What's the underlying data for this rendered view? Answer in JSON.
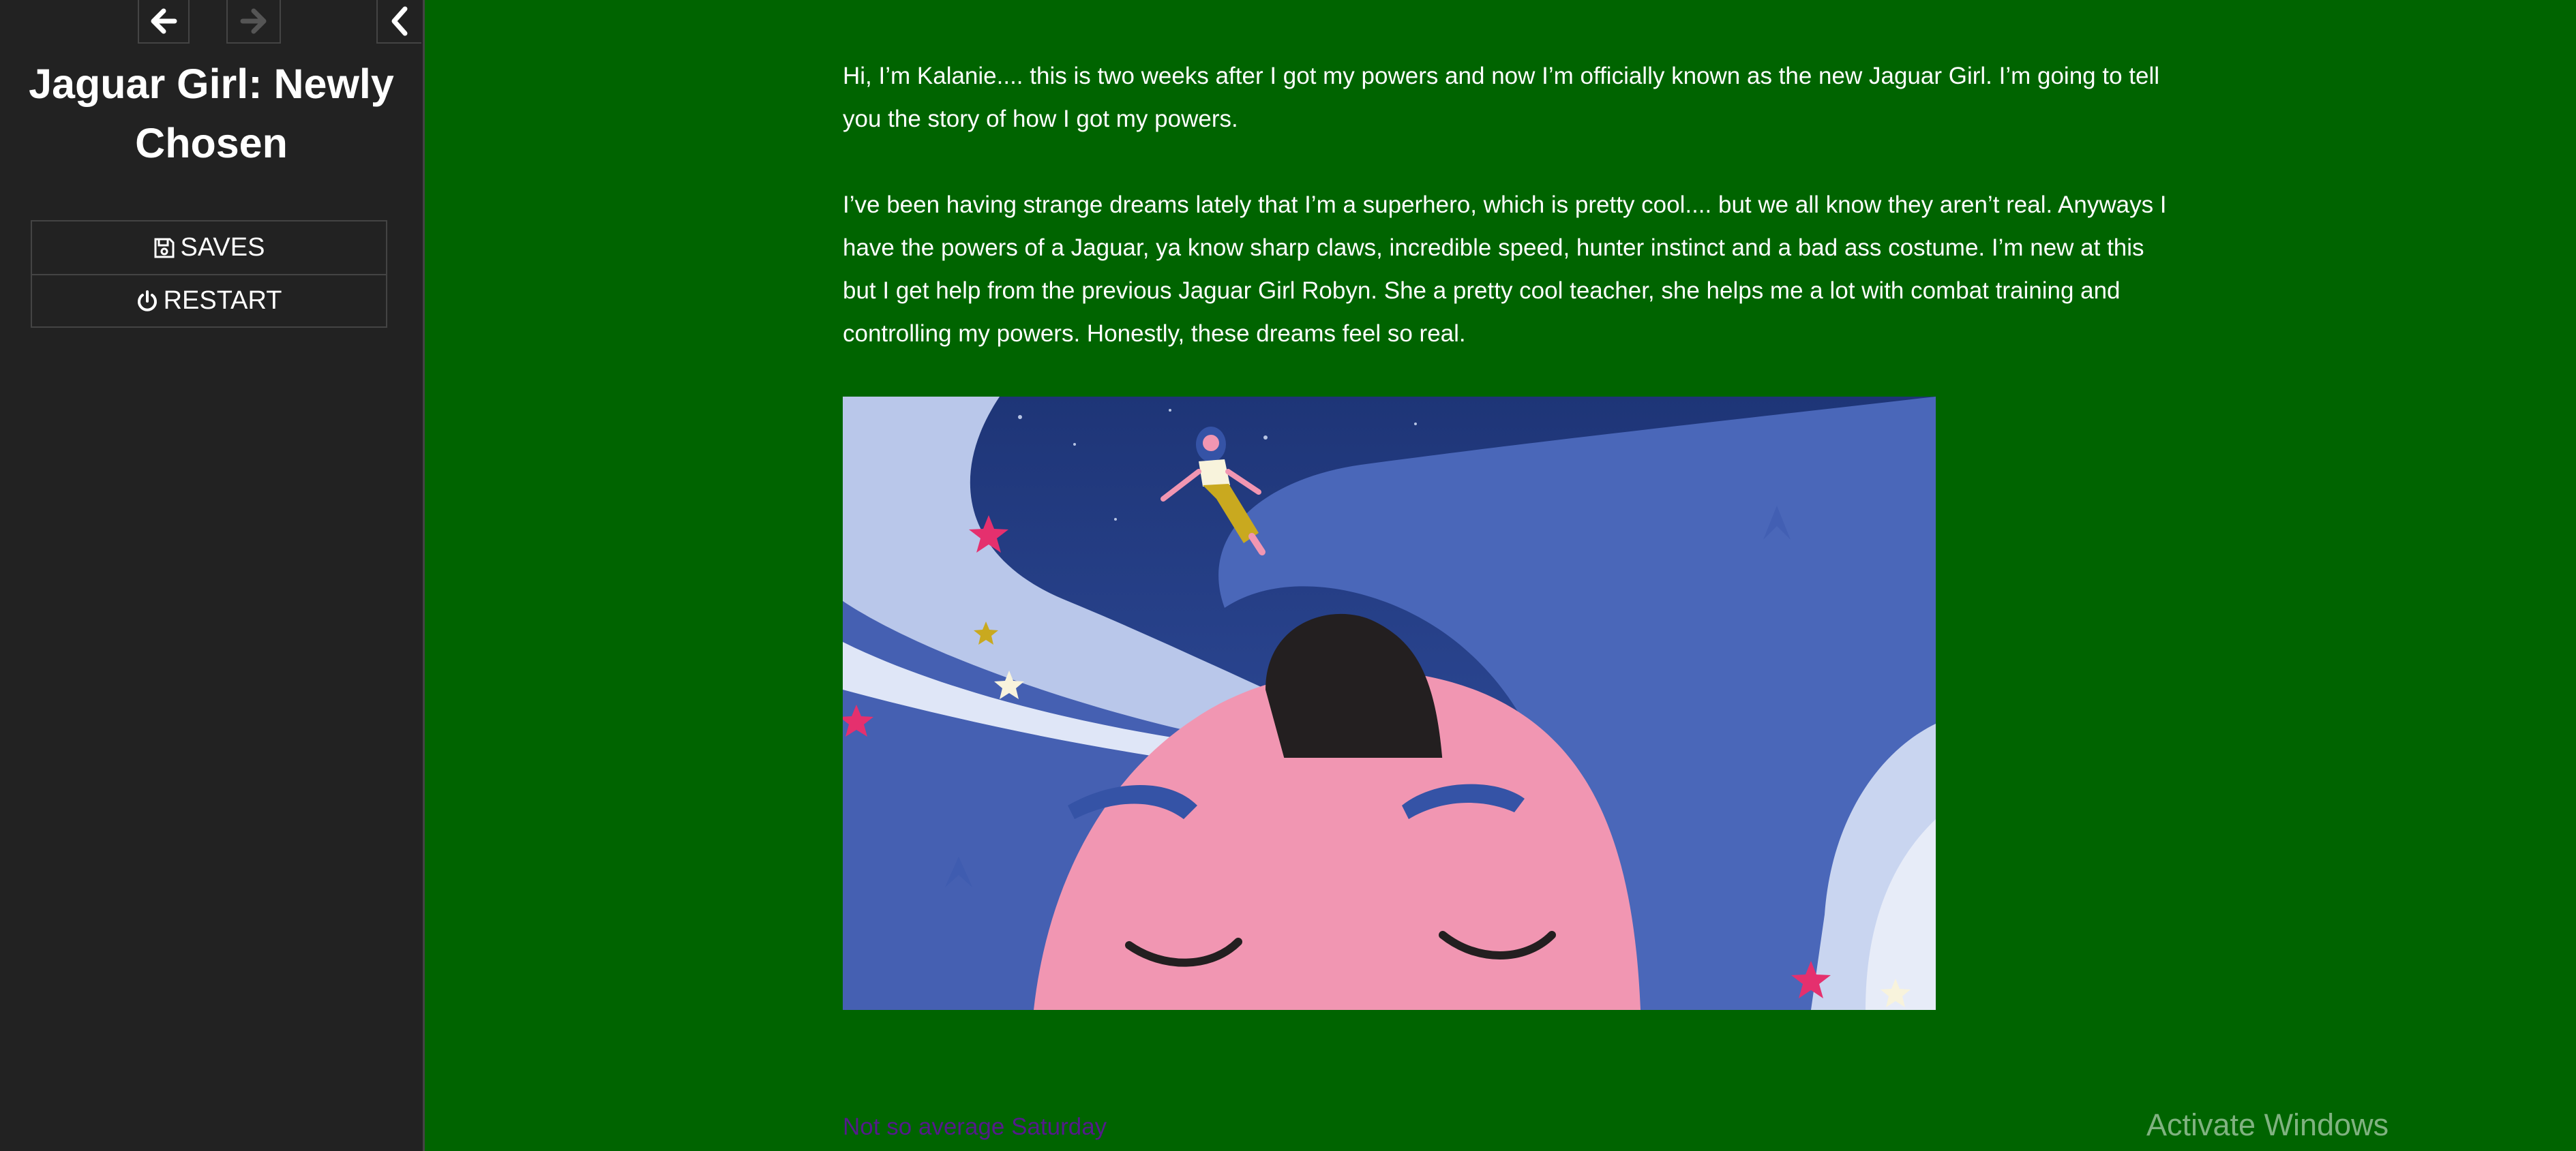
{
  "sidebar": {
    "back_icon": "arrow-left-icon",
    "forward_icon": "arrow-right-icon",
    "toggle_icon": "chevron-left-icon",
    "title": "Jaguar Girl: Newly Chosen",
    "menu": [
      {
        "label": "SAVES",
        "icon": "floppy-disk-icon"
      },
      {
        "label": "RESTART",
        "icon": "power-icon"
      }
    ]
  },
  "passage": {
    "paragraphs": [
      "Hi, I’m Kalanie.... this is two weeks after I got my powers and now I’m officially known as the new Jaguar Girl. I’m going to tell you the story of how I got my powers.",
      "I’ve been having strange dreams lately that I’m a superhero, which is pretty cool.... but we all know they aren’t real. Anyways I have the powers of a Jaguar, ya know sharp claws, incredible speed, hunter instinct and a bad ass costume. I’m new at this but I get help from the previous Jaguar Girl Robyn. She a pretty cool teacher, she helps me a lot with combat training and controlling my powers. Honestly, these dreams feel so real."
    ],
    "next_link": "Not so average Saturday"
  },
  "watermark": "Activate Windows",
  "colors": {
    "background": "#006400",
    "sidebar": "#222222",
    "text": "#ffffff",
    "link": "#551a8b"
  }
}
